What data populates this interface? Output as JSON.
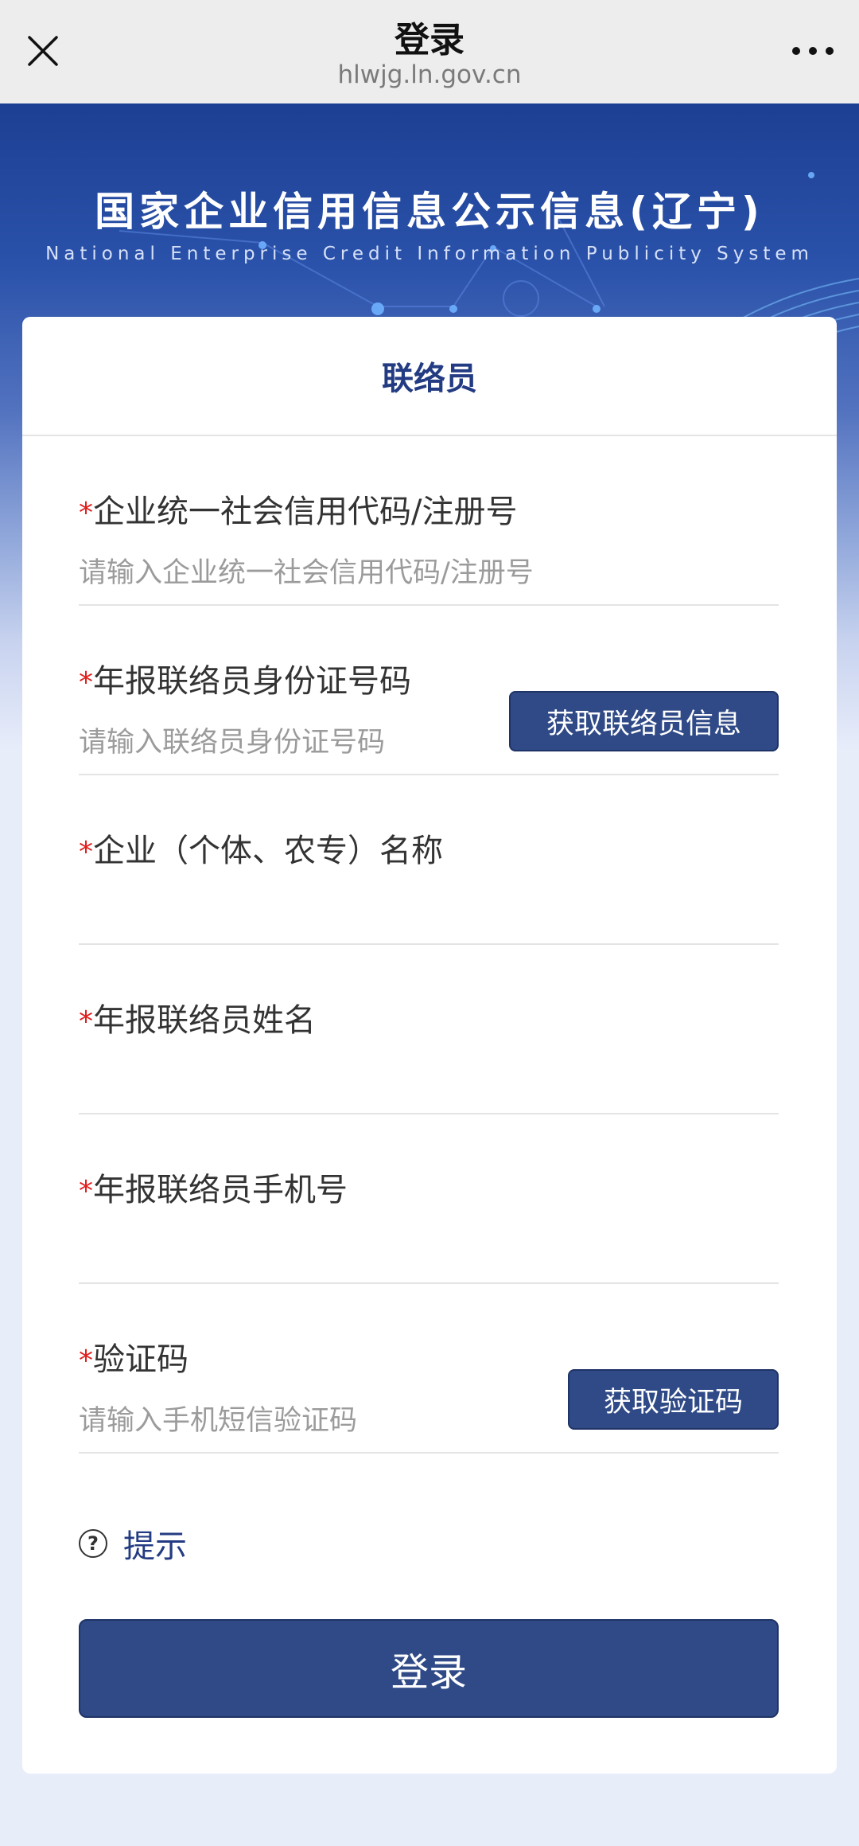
{
  "navbar": {
    "title": "登录",
    "domain": "hlwjg.ln.gov.cn"
  },
  "hero": {
    "title": "国家企业信用信息公示信息(辽宁)",
    "subtitle": "National Enterprise Credit Information Publicity System"
  },
  "card": {
    "header_title": "联络员"
  },
  "form": {
    "required_mark": "*",
    "credit_code": {
      "label": "企业统一社会信用代码/注册号",
      "placeholder": "请输入企业统一社会信用代码/注册号",
      "value": ""
    },
    "id_number": {
      "label": "年报联络员身份证号码",
      "placeholder": "请输入联络员身份证号码",
      "value": "",
      "button_label": "获取联络员信息"
    },
    "company_name": {
      "label": "企业（个体、农专）名称",
      "placeholder": "",
      "value": ""
    },
    "contact_name": {
      "label": "年报联络员姓名",
      "placeholder": "",
      "value": ""
    },
    "phone": {
      "label": "年报联络员手机号",
      "placeholder": "",
      "value": ""
    },
    "verify_code": {
      "label": "验证码",
      "placeholder": "请输入手机短信验证码",
      "value": "",
      "button_label": "获取验证码"
    }
  },
  "tip": {
    "icon": "question-circle-icon",
    "icon_glyph": "?",
    "label": "提示"
  },
  "login_button": {
    "label": "登录"
  },
  "colors": {
    "primary": "#2f4a86",
    "title_blue": "#233b82",
    "required": "#e02020",
    "hero_top": "#1d3f93",
    "page_bg": "#e8edfa"
  }
}
